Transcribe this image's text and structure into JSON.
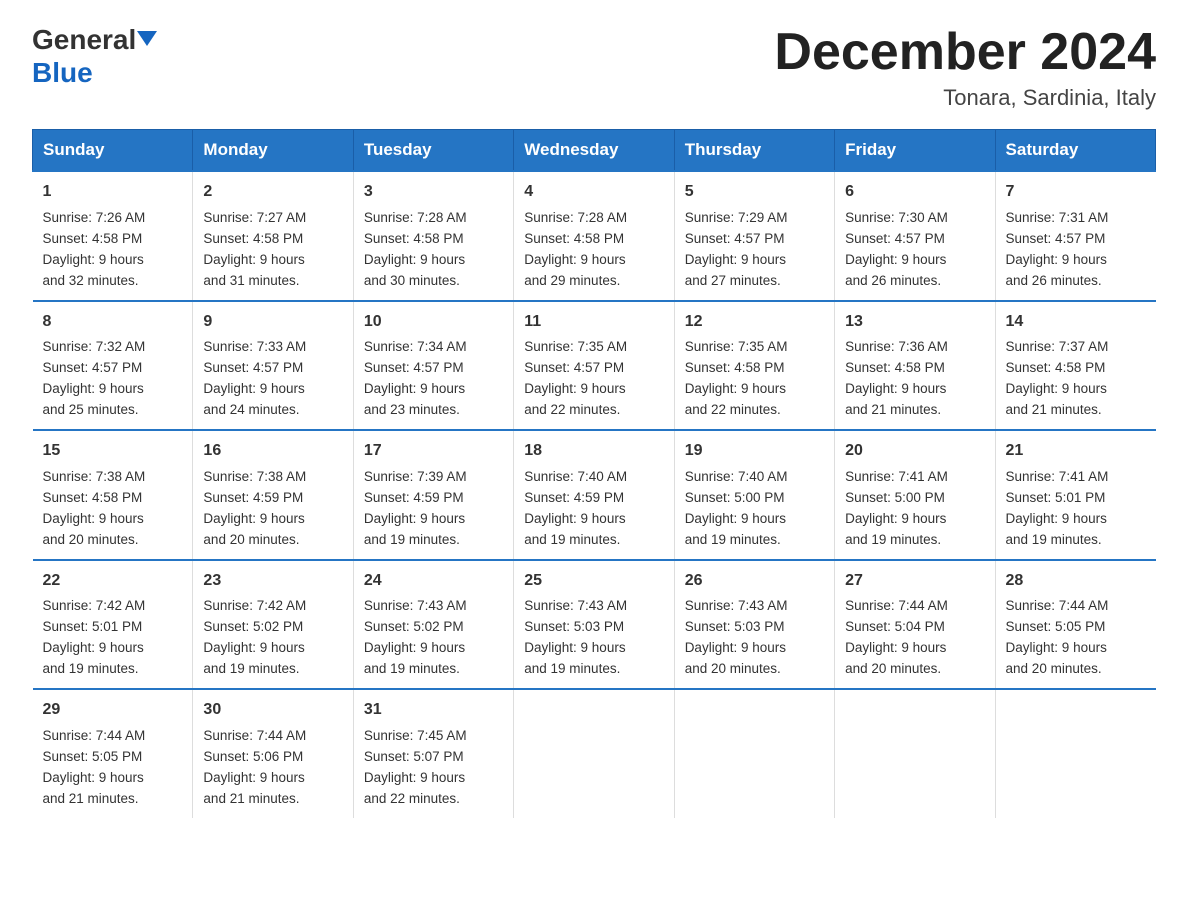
{
  "header": {
    "logo_general": "General",
    "logo_blue": "Blue",
    "month_title": "December 2024",
    "location": "Tonara, Sardinia, Italy"
  },
  "weekdays": [
    "Sunday",
    "Monday",
    "Tuesday",
    "Wednesday",
    "Thursday",
    "Friday",
    "Saturday"
  ],
  "weeks": [
    [
      {
        "day": "1",
        "sunrise": "7:26 AM",
        "sunset": "4:58 PM",
        "daylight": "9 hours and 32 minutes."
      },
      {
        "day": "2",
        "sunrise": "7:27 AM",
        "sunset": "4:58 PM",
        "daylight": "9 hours and 31 minutes."
      },
      {
        "day": "3",
        "sunrise": "7:28 AM",
        "sunset": "4:58 PM",
        "daylight": "9 hours and 30 minutes."
      },
      {
        "day": "4",
        "sunrise": "7:28 AM",
        "sunset": "4:58 PM",
        "daylight": "9 hours and 29 minutes."
      },
      {
        "day": "5",
        "sunrise": "7:29 AM",
        "sunset": "4:57 PM",
        "daylight": "9 hours and 27 minutes."
      },
      {
        "day": "6",
        "sunrise": "7:30 AM",
        "sunset": "4:57 PM",
        "daylight": "9 hours and 26 minutes."
      },
      {
        "day": "7",
        "sunrise": "7:31 AM",
        "sunset": "4:57 PM",
        "daylight": "9 hours and 26 minutes."
      }
    ],
    [
      {
        "day": "8",
        "sunrise": "7:32 AM",
        "sunset": "4:57 PM",
        "daylight": "9 hours and 25 minutes."
      },
      {
        "day": "9",
        "sunrise": "7:33 AM",
        "sunset": "4:57 PM",
        "daylight": "9 hours and 24 minutes."
      },
      {
        "day": "10",
        "sunrise": "7:34 AM",
        "sunset": "4:57 PM",
        "daylight": "9 hours and 23 minutes."
      },
      {
        "day": "11",
        "sunrise": "7:35 AM",
        "sunset": "4:57 PM",
        "daylight": "9 hours and 22 minutes."
      },
      {
        "day": "12",
        "sunrise": "7:35 AM",
        "sunset": "4:58 PM",
        "daylight": "9 hours and 22 minutes."
      },
      {
        "day": "13",
        "sunrise": "7:36 AM",
        "sunset": "4:58 PM",
        "daylight": "9 hours and 21 minutes."
      },
      {
        "day": "14",
        "sunrise": "7:37 AM",
        "sunset": "4:58 PM",
        "daylight": "9 hours and 21 minutes."
      }
    ],
    [
      {
        "day": "15",
        "sunrise": "7:38 AM",
        "sunset": "4:58 PM",
        "daylight": "9 hours and 20 minutes."
      },
      {
        "day": "16",
        "sunrise": "7:38 AM",
        "sunset": "4:59 PM",
        "daylight": "9 hours and 20 minutes."
      },
      {
        "day": "17",
        "sunrise": "7:39 AM",
        "sunset": "4:59 PM",
        "daylight": "9 hours and 19 minutes."
      },
      {
        "day": "18",
        "sunrise": "7:40 AM",
        "sunset": "4:59 PM",
        "daylight": "9 hours and 19 minutes."
      },
      {
        "day": "19",
        "sunrise": "7:40 AM",
        "sunset": "5:00 PM",
        "daylight": "9 hours and 19 minutes."
      },
      {
        "day": "20",
        "sunrise": "7:41 AM",
        "sunset": "5:00 PM",
        "daylight": "9 hours and 19 minutes."
      },
      {
        "day": "21",
        "sunrise": "7:41 AM",
        "sunset": "5:01 PM",
        "daylight": "9 hours and 19 minutes."
      }
    ],
    [
      {
        "day": "22",
        "sunrise": "7:42 AM",
        "sunset": "5:01 PM",
        "daylight": "9 hours and 19 minutes."
      },
      {
        "day": "23",
        "sunrise": "7:42 AM",
        "sunset": "5:02 PM",
        "daylight": "9 hours and 19 minutes."
      },
      {
        "day": "24",
        "sunrise": "7:43 AM",
        "sunset": "5:02 PM",
        "daylight": "9 hours and 19 minutes."
      },
      {
        "day": "25",
        "sunrise": "7:43 AM",
        "sunset": "5:03 PM",
        "daylight": "9 hours and 19 minutes."
      },
      {
        "day": "26",
        "sunrise": "7:43 AM",
        "sunset": "5:03 PM",
        "daylight": "9 hours and 20 minutes."
      },
      {
        "day": "27",
        "sunrise": "7:44 AM",
        "sunset": "5:04 PM",
        "daylight": "9 hours and 20 minutes."
      },
      {
        "day": "28",
        "sunrise": "7:44 AM",
        "sunset": "5:05 PM",
        "daylight": "9 hours and 20 minutes."
      }
    ],
    [
      {
        "day": "29",
        "sunrise": "7:44 AM",
        "sunset": "5:05 PM",
        "daylight": "9 hours and 21 minutes."
      },
      {
        "day": "30",
        "sunrise": "7:44 AM",
        "sunset": "5:06 PM",
        "daylight": "9 hours and 21 minutes."
      },
      {
        "day": "31",
        "sunrise": "7:45 AM",
        "sunset": "5:07 PM",
        "daylight": "9 hours and 22 minutes."
      },
      null,
      null,
      null,
      null
    ]
  ],
  "labels": {
    "sunrise": "Sunrise:",
    "sunset": "Sunset:",
    "daylight": "Daylight:"
  }
}
